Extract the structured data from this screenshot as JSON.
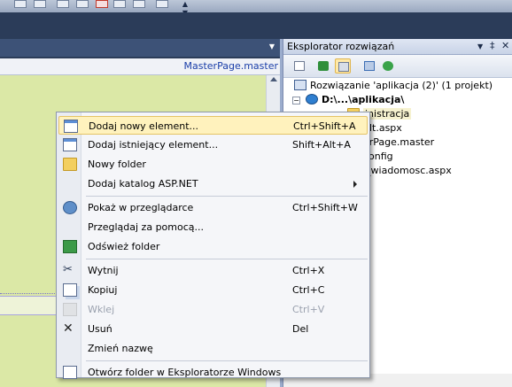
{
  "editor": {
    "filename": "MasterPage.master"
  },
  "solution_explorer": {
    "title": "Eksplorator rozwiązań",
    "controls": {
      "dropdown": "▼",
      "pin": "‡",
      "close": "✕"
    },
    "tree": [
      {
        "text": "Rozwiązanie 'aplikacja (2)' (1 projekt)",
        "icon": "solution-icon"
      },
      {
        "text": "D:\\...\\aplikacja\\",
        "icon": "website-icon",
        "expander": "−",
        "bold": true
      },
      {
        "text": "inistracja",
        "icon": "folder-icon",
        "selected": true
      },
      {
        "text": "ult.aspx",
        "icon": "aspx-file-icon"
      },
      {
        "text": "erPage.master",
        "icon": "master-file-icon"
      },
      {
        "text": "config",
        "icon": "config-file-icon"
      },
      {
        "text": "i_wiadomosc.aspx",
        "icon": "aspx-file-icon"
      }
    ]
  },
  "context_menu": {
    "items": [
      {
        "label": "Dodaj nowy element...",
        "shortcut": "Ctrl+Shift+A",
        "icon": "add-new-item-icon",
        "highlighted": true
      },
      {
        "label": "Dodaj istniejący element...",
        "shortcut": "Shift+Alt+A",
        "icon": "add-existing-item-icon"
      },
      {
        "label": "Nowy folder",
        "shortcut": "",
        "icon": "new-folder-icon"
      },
      {
        "label": "Dodaj katalog ASP.NET",
        "shortcut": "",
        "icon": "",
        "submenu": true
      },
      {
        "separator": true
      },
      {
        "label": "Pokaż w przeglądarce",
        "shortcut": "Ctrl+Shift+W",
        "icon": "view-in-browser-icon"
      },
      {
        "label": "Przeglądaj za pomocą...",
        "shortcut": "",
        "icon": ""
      },
      {
        "label": "Odśwież folder",
        "shortcut": "",
        "icon": "refresh-icon"
      },
      {
        "separator": true
      },
      {
        "label": "Wytnij",
        "shortcut": "Ctrl+X",
        "icon": "cut-icon"
      },
      {
        "label": "Kopiuj",
        "shortcut": "Ctrl+C",
        "icon": "copy-icon"
      },
      {
        "label": "Wklej",
        "shortcut": "Ctrl+V",
        "icon": "paste-icon",
        "disabled": true
      },
      {
        "label": "Usuń",
        "shortcut": "Del",
        "icon": "delete-icon"
      },
      {
        "label": "Zmień nazwę",
        "shortcut": "",
        "icon": ""
      },
      {
        "separator": true
      },
      {
        "label": "Otwórz folder w Eksploratorze Windows",
        "shortcut": "",
        "icon": "open-folder-explorer-icon"
      }
    ]
  },
  "colors": {
    "editor_background": "#dbe8a6",
    "menu_highlight": "#fff2bd",
    "link_blue": "#1a3ea8"
  }
}
